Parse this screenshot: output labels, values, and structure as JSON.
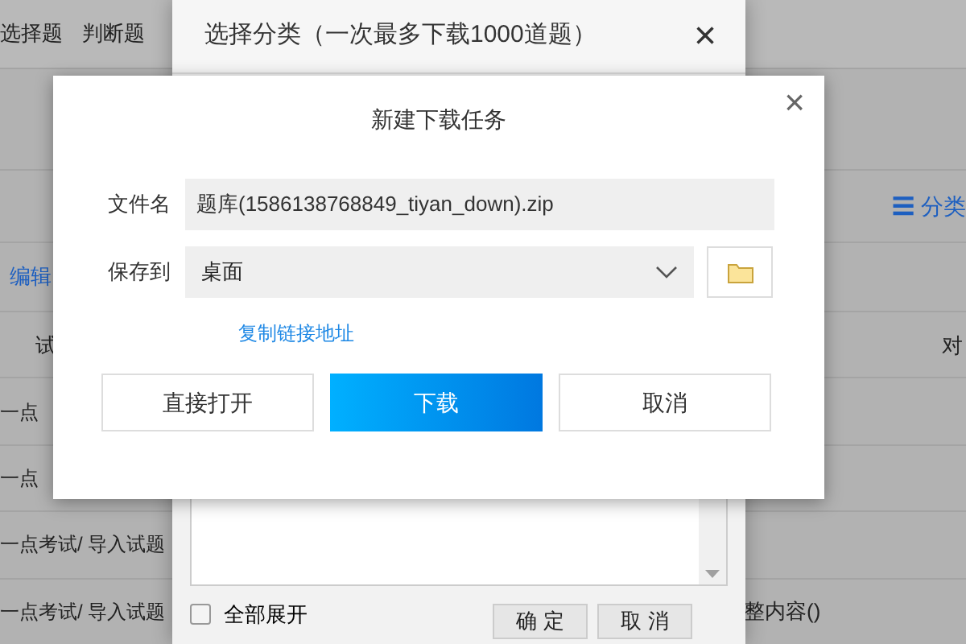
{
  "background": {
    "tabs": [
      "选择题",
      "判断题"
    ],
    "category_icon": "☰",
    "category_link": "分类",
    "edit_link": "编辑",
    "column_1": "试",
    "column_2": "对",
    "rows": [
      {
        "path": "一点"
      },
      {
        "path": "一点"
      },
      {
        "path": "一点考试/ 导入试题"
      },
      {
        "path": "一点考试/ 导入试题",
        "extra": "整内容()"
      }
    ]
  },
  "category_dialog": {
    "title": "选择分类（一次最多下载1000道题）",
    "close": "×",
    "expand_all": {
      "label": "全部展开",
      "checked": false
    },
    "buttons": [
      "确 定",
      "取 消"
    ]
  },
  "download_dialog": {
    "title": "新建下载任务",
    "close": "×",
    "fields": [
      {
        "kind": "text",
        "label": "文件名",
        "value": "题库(1586138768849_tiyan_down).zip"
      },
      {
        "kind": "select",
        "label": "保存到",
        "value": "桌面"
      }
    ],
    "copy_link": "复制链接地址",
    "buttons": [
      {
        "label": "直接打开",
        "primary": false
      },
      {
        "label": "下载",
        "primary": true
      },
      {
        "label": "取消",
        "primary": false
      }
    ]
  }
}
